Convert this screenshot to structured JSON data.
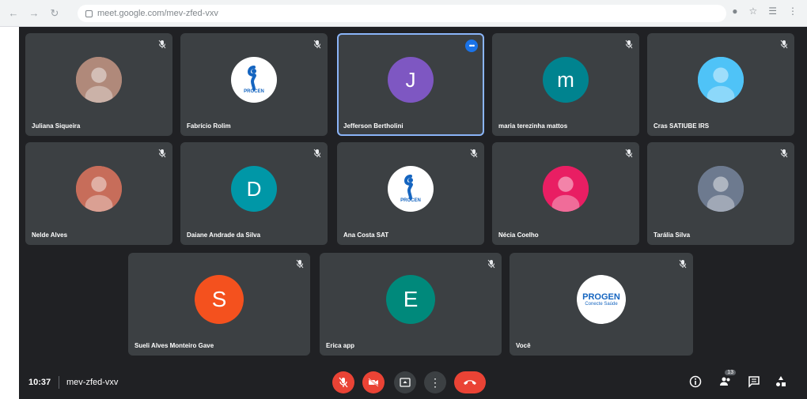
{
  "browser": {
    "url": "meet.google.com/mev-zfed-vxv"
  },
  "participants": [
    {
      "name": "Juliana Siqueira",
      "avatar_type": "photo",
      "avatar_color": "#b0897a"
    },
    {
      "name": "Fabrício Rolim",
      "avatar_type": "logo",
      "avatar_color": "#ffffff"
    },
    {
      "name": "Jefferson Bertholini",
      "avatar_type": "letter",
      "letter": "J",
      "avatar_color": "#7e57c2"
    },
    {
      "name": "maria terezinha mattos",
      "avatar_type": "letter",
      "letter": "m",
      "avatar_color": "#00838f"
    },
    {
      "name": "Cras SATIUBE IRS",
      "avatar_type": "photo",
      "avatar_color": "#4fc3f7"
    },
    {
      "name": "Nelde Alves",
      "avatar_type": "photo",
      "avatar_color": "#c76d5a"
    },
    {
      "name": "Daiane Andrade da Silva",
      "avatar_type": "letter",
      "letter": "D",
      "avatar_color": "#0097a7"
    },
    {
      "name": "Ana Costa SAT",
      "avatar_type": "logo",
      "avatar_color": "#ffffff"
    },
    {
      "name": "Nécia Coelho",
      "avatar_type": "photo",
      "avatar_color": "#e91e63"
    },
    {
      "name": "Tarália Silva",
      "avatar_type": "photo",
      "avatar_color": "#6d7a8f"
    },
    {
      "name": "Sueli Alves Monteiro Gave",
      "avatar_type": "letter",
      "letter": "S",
      "avatar_color": "#f4511e"
    },
    {
      "name": "Erica app",
      "avatar_type": "letter",
      "letter": "E",
      "avatar_color": "#00897b"
    },
    {
      "name": "Você",
      "avatar_type": "progen",
      "avatar_color": "#ffffff"
    }
  ],
  "logo_text": {
    "procen": "PROCEN",
    "progen": "PROGEN",
    "progen_sub": "Conecte Saúde"
  },
  "bottom_bar": {
    "time": "10:37",
    "meeting_code": "mev-zfed-vxv",
    "participant_count": "13",
    "controls": [
      "mic-off",
      "camera-off",
      "present",
      "more",
      "hang-up"
    ]
  },
  "colors": {
    "meet_bg": "#202124",
    "tile_bg": "#3c4043",
    "danger": "#ea4335",
    "active_border": "#8ab4f8"
  }
}
